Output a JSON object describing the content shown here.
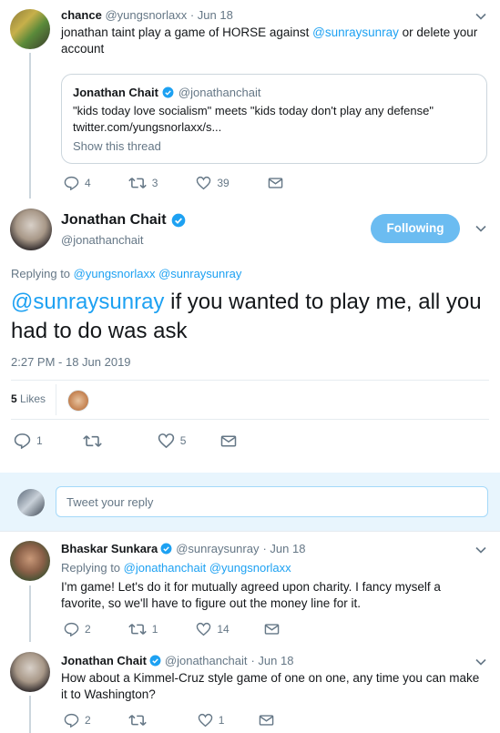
{
  "tweet1": {
    "name": "chance",
    "handle": "@yungsnorlaxx",
    "date": "· Jun 18",
    "text_before": "jonathan taint play a game of HORSE against ",
    "mention": "@sunraysunray",
    "text_after": " or delete your account",
    "quote": {
      "name": "Jonathan Chait",
      "handle": "@jonathanchait",
      "text": "\"kids today love socialism\" meets \"kids today don't play any defense\"",
      "link": "twitter.com/yungsnorlaxx/s...",
      "show_thread": "Show this thread"
    },
    "replies": "4",
    "retweets": "3",
    "likes": "39"
  },
  "main": {
    "name": "Jonathan Chait",
    "handle": "@jonathanchait",
    "follow_label": "Following",
    "replying_prefix": "Replying to",
    "replying_to_1": "@yungsnorlaxx",
    "replying_to_2": "@sunraysunray",
    "mention": "@sunraysunray",
    "text": " if you wanted to play me, all you had to do was ask",
    "timestamp": "2:27 PM - 18 Jun 2019",
    "likes_count": "5",
    "likes_label": "Likes",
    "replies": "1",
    "retweets": "",
    "hearts": "5"
  },
  "reply_box": {
    "placeholder": "Tweet your reply"
  },
  "tweet3": {
    "name": "Bhaskar Sunkara",
    "handle": "@sunraysunray",
    "date": "· Jun 18",
    "replying_prefix": "Replying to",
    "replying_to_1": "@jonathanchait",
    "replying_to_2": "@yungsnorlaxx",
    "text": "I'm game! Let's do it for mutually agreed upon charity. I fancy myself a favorite, so we'll have to figure out the money line for it.",
    "replies": "2",
    "retweets": "1",
    "likes": "14"
  },
  "tweet4": {
    "name": "Jonathan Chait",
    "handle": "@jonathanchait",
    "date": "· Jun 18",
    "text": "How about a Kimmel-Cruz style game of one on one, any time you can make it to Washington?",
    "replies": "2",
    "retweets": "",
    "likes": "1"
  },
  "colors": {
    "accent": "#1da1f2",
    "text": "#14171a",
    "muted": "#657786",
    "divider": "#e6ecf0",
    "thread_line": "#ccd6dd"
  },
  "icons": [
    "chevron-down-icon",
    "verified-badge-icon",
    "reply-icon",
    "retweet-icon",
    "like-icon",
    "message-icon"
  ]
}
